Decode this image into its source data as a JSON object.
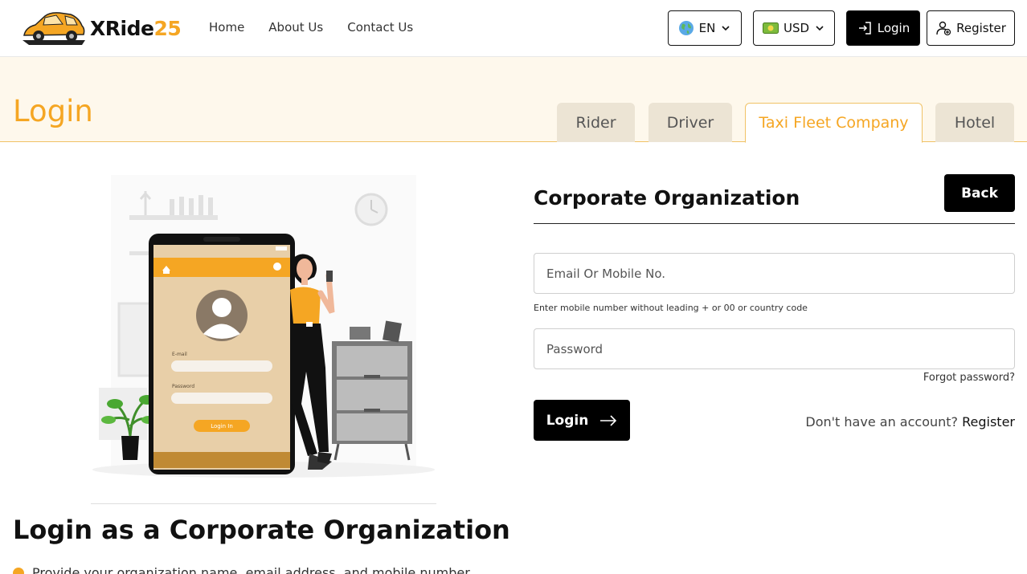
{
  "brand": {
    "name_main": "XRide",
    "name_num": "25"
  },
  "nav": {
    "home": "Home",
    "about": "About Us",
    "contact": "Contact Us"
  },
  "header_buttons": {
    "language": "EN",
    "currency": "USD",
    "login": "Login",
    "register": "Register"
  },
  "banner": {
    "title": "Login",
    "tabs": [
      {
        "label": "Rider"
      },
      {
        "label": "Driver"
      },
      {
        "label": "Taxi Fleet Company",
        "active": true
      },
      {
        "label": "Hotel"
      }
    ]
  },
  "illustration": {
    "field_email": "E-mail",
    "field_password": "Password",
    "button": "Login In"
  },
  "form": {
    "title": "Corporate Organization",
    "back": "Back",
    "email_placeholder": "Email Or Mobile No.",
    "hint": "Enter mobile number without leading + or 00 or country code",
    "password_placeholder": "Password",
    "forgot": "Forgot password?",
    "login": "Login",
    "no_account": "Don't have an account?",
    "register": "Register"
  },
  "bottom": {
    "title": "Login as a Corporate Organization",
    "bullet_partial": "Provide your organization name, email address, and mobile number"
  },
  "colors": {
    "accent": "#f5a623",
    "banner_bg": "#fef8ec",
    "dark": "#000000"
  },
  "icons": [
    "car-logo-icon",
    "globe-icon",
    "chevron-down-icon",
    "money-icon",
    "login-icon",
    "user-plus-icon",
    "arrow-right-icon"
  ]
}
